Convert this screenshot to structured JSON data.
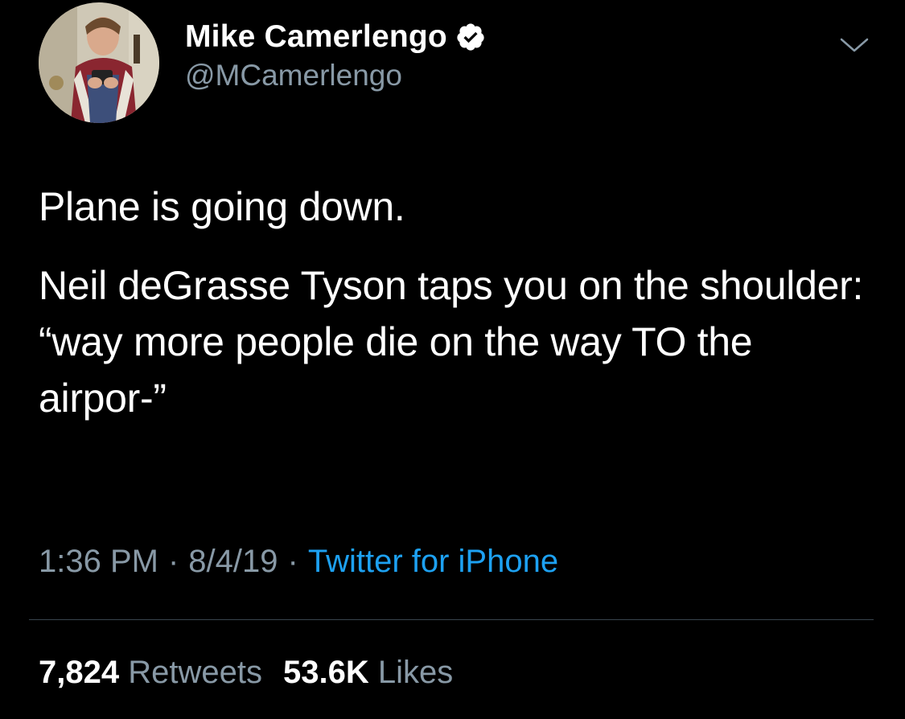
{
  "author": {
    "display_name": "Mike Camerlengo",
    "handle": "@MCamerlengo",
    "verified_icon": "verified-badge-icon",
    "avatar": "profile-photo"
  },
  "tweet": {
    "paragraphs": [
      "Plane is going down.",
      "Neil deGrasse Tyson taps you on the shoulder: “way more people die on the way TO the airpor-”"
    ]
  },
  "meta": {
    "time": "1:36 PM",
    "date": "8/4/19",
    "source": "Twitter for iPhone",
    "separator": "·"
  },
  "stats": {
    "retweets_count": "7,824",
    "retweets_label": "Retweets",
    "likes_count": "53.6K",
    "likes_label": "Likes"
  },
  "colors": {
    "background": "#000000",
    "text": "#ffffff",
    "secondary": "#8899a6",
    "link": "#1da1f2",
    "divider": "#38444d"
  },
  "icons": {
    "menu": "chevron-down-icon"
  }
}
